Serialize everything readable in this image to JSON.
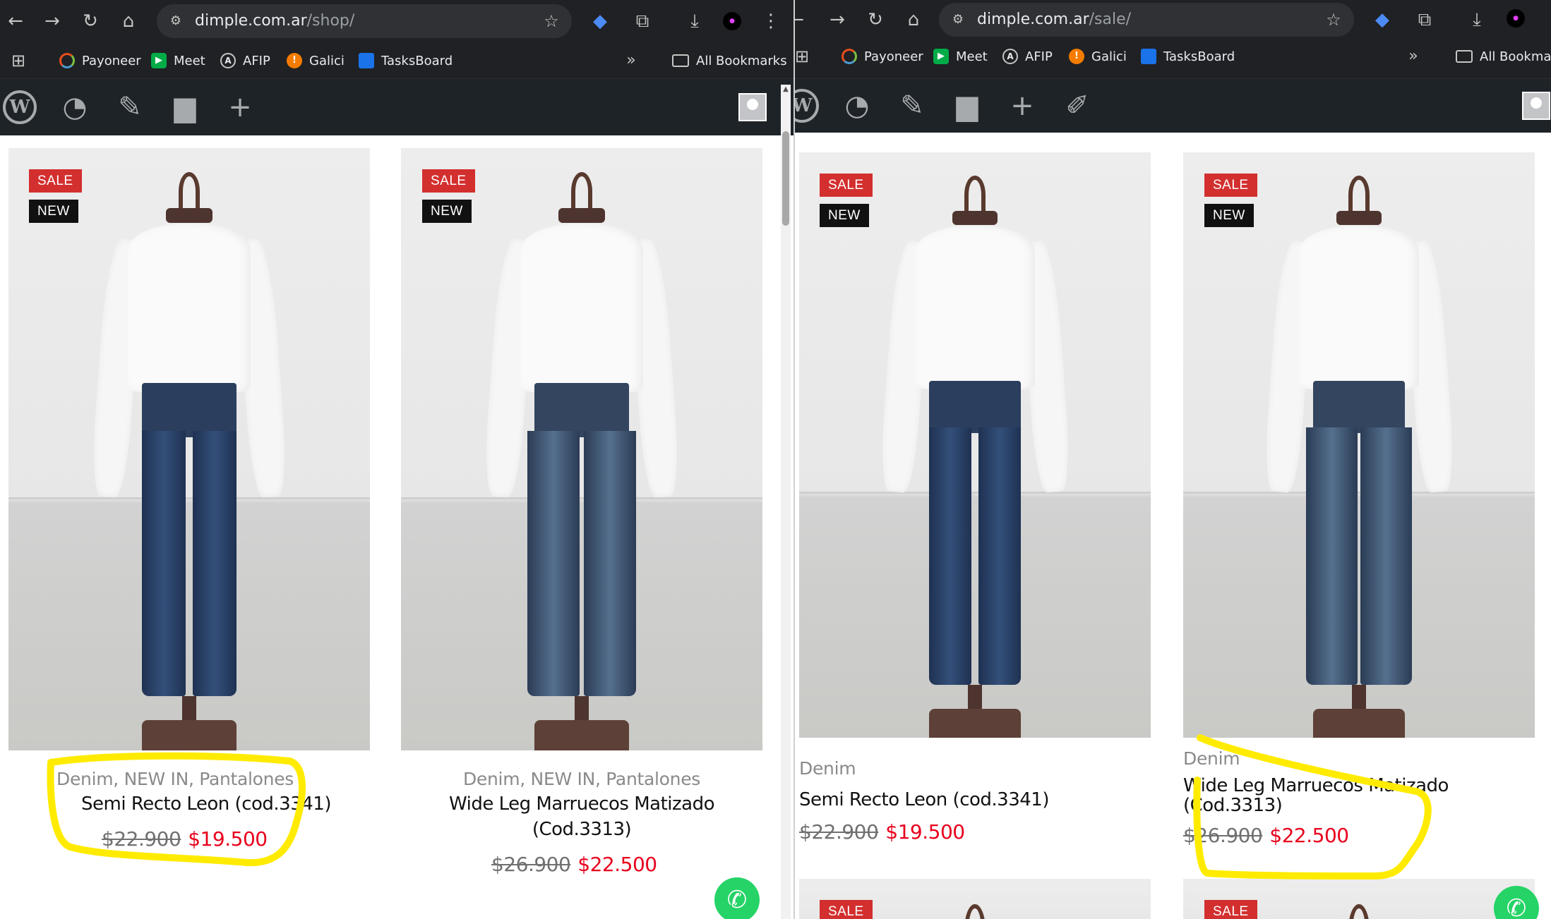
{
  "left": {
    "url_host": "dimple.com.ar",
    "url_path": "/shop/",
    "bookmarks": [
      "Payoneer",
      "Meet",
      "AFIP",
      "Galici",
      "TasksBoard"
    ],
    "all_bookmarks": "All Bookmarks",
    "products": [
      {
        "badge_sale": "SALE",
        "badge_new": "NEW",
        "categories": "Denim, NEW IN, Pantalones",
        "title": "Semi Recto Leon (cod.3341)",
        "old_price": "$22.900",
        "new_price": "$19.500"
      },
      {
        "badge_sale": "SALE",
        "badge_new": "NEW",
        "categories": "Denim, NEW IN, Pantalones",
        "title": "Wide Leg Marruecos Matizado (Cod.3313)",
        "old_price": "$26.900",
        "new_price": "$22.500"
      }
    ]
  },
  "right": {
    "url_host": "dimple.com.ar",
    "url_path": "/sale/",
    "bookmarks": [
      "Payoneer",
      "Meet",
      "AFIP",
      "Galici",
      "TasksBoard"
    ],
    "all_bookmarks": "All Bookmark",
    "products": [
      {
        "badge_sale": "SALE",
        "badge_new": "NEW",
        "categories": "Denim",
        "title": "Semi Recto Leon (cod.3341)",
        "old_price": "$22.900",
        "new_price": "$19.500"
      },
      {
        "badge_sale": "SALE",
        "badge_new": "NEW",
        "categories": "Denim",
        "title": "Wide Leg Marruecos Matizado (Cod.3313)",
        "old_price": "$26.900",
        "new_price": "$22.500"
      },
      {
        "badge_sale": "SALE"
      },
      {
        "badge_sale": "SALE"
      }
    ]
  },
  "icons": {
    "back": "arrow-left-icon",
    "forward": "arrow-right-icon",
    "reload": "reload-icon",
    "home": "home-icon",
    "site_info": "tune-icon",
    "bookmark_star": "star-icon",
    "extension": "puzzle-icon",
    "download": "download-icon",
    "menu": "kebab-menu-icon",
    "wordpress": "wordpress-logo-icon",
    "dashboard": "gauge-icon",
    "customize": "paintbrush-icon",
    "comments": "comment-bubble-icon",
    "new": "plus-icon",
    "edit": "pencil-icon",
    "whatsapp": "whatsapp-icon"
  },
  "colors": {
    "sale_badge": "#d32f2f",
    "new_badge": "#111111",
    "sale_price": "#e8001c",
    "annotation_highlight": "#ffeb00",
    "whatsapp": "#25d366",
    "browser_chrome": "#202124",
    "wp_admin_bar": "#1d2327"
  }
}
